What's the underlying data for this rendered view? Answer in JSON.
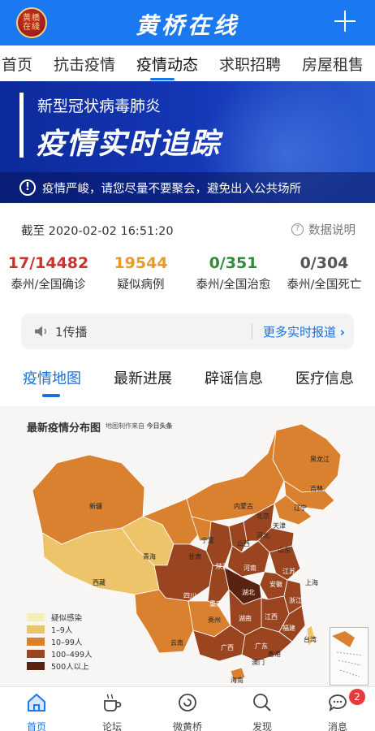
{
  "header": {
    "title": "黄桥在线",
    "logo_text": "黄桥在线"
  },
  "nav": {
    "items": [
      "首页",
      "抗击疫情",
      "疫情动态",
      "求职招聘",
      "房屋租售"
    ],
    "active": "疫情动态"
  },
  "banner": {
    "subtitle": "新型冠状病毒肺炎",
    "title": "疫情实时追踪",
    "notice": "疫情严峻，请您尽量不要聚会，避免出入公共场所"
  },
  "status": {
    "timestamp": "截至 2020-02-02 16:51:20",
    "data_help": "数据说明"
  },
  "stats": [
    {
      "value": "17/14482",
      "label": "泰州/全国确诊",
      "color": "#c8322a"
    },
    {
      "value": "19544",
      "label": "疑似病例",
      "color": "#e89a28"
    },
    {
      "value": "0/351",
      "label": "泰州/全国治愈",
      "color": "#2e8b3a"
    },
    {
      "value": "0/304",
      "label": "泰州/全国死亡",
      "color": "#555555"
    }
  ],
  "broadcast": {
    "text": "1传播",
    "more": "更多实时报道"
  },
  "subtabs": {
    "items": [
      "疫情地图",
      "最新进展",
      "辟谣信息",
      "医疗信息"
    ],
    "active": "疫情地图"
  },
  "map": {
    "title": "最新疫情分布图",
    "source": "地图制作来自",
    "source_brand": "今日头条",
    "legend": [
      {
        "label": "疑似感染",
        "color": "#f7efb8"
      },
      {
        "label": "1–9人",
        "color": "#eec46a"
      },
      {
        "label": "10–99人",
        "color": "#d9812e"
      },
      {
        "label": "100–499人",
        "color": "#9a4520"
      },
      {
        "label": "500人以上",
        "color": "#5a2210"
      }
    ],
    "provinces": [
      "黑龙江",
      "吉林",
      "辽宁",
      "内蒙古",
      "北京",
      "天津",
      "河北",
      "新疆",
      "宁夏",
      "山西",
      "山东",
      "青海",
      "甘肃",
      "陕西",
      "河南",
      "江苏",
      "西藏",
      "四川",
      "湖北",
      "安徽",
      "上海",
      "重庆",
      "浙江",
      "湖南",
      "江西",
      "贵州",
      "云南",
      "福建",
      "广西",
      "广东",
      "台湾",
      "香港",
      "澳门",
      "海南"
    ]
  },
  "bottom_nav": {
    "items": [
      "首页",
      "论坛",
      "微黄桥",
      "发现",
      "消息"
    ],
    "active": "首页",
    "message_badge": "2"
  }
}
